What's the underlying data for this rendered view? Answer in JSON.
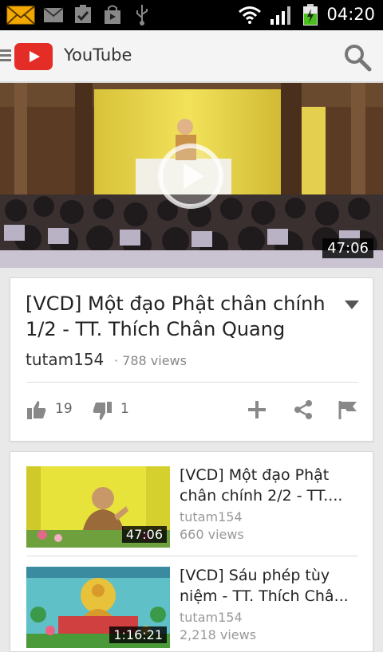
{
  "status": {
    "time": "04:20",
    "icons": [
      "email-icon",
      "gmail-icon",
      "task-icon",
      "shopping-bag-icon",
      "usb-icon",
      "wifi-icon",
      "signal-icon",
      "battery-charging-icon"
    ]
  },
  "appbar": {
    "title": "YouTube"
  },
  "player": {
    "duration": "47:06"
  },
  "video": {
    "title": "[VCD] Một đạo Phật chân chính 1/2 - TT. Thích Chân Quang",
    "channel": "tutam154",
    "views": "788 views",
    "likes": "19",
    "dislikes": "1"
  },
  "related": [
    {
      "title": "[VCD] Một đạo Phật chân chính 2/2 - TT....",
      "channel": "tutam154",
      "views": "660 views",
      "duration": "47:06"
    },
    {
      "title": "[VCD] Sáu phép tùy niệm - TT. Thích Châ...",
      "channel": "tutam154",
      "views": "2,218 views",
      "duration": "1:16:21"
    }
  ],
  "colors": {
    "brand_red": "#e52d27",
    "background": "#e9e9e9"
  }
}
